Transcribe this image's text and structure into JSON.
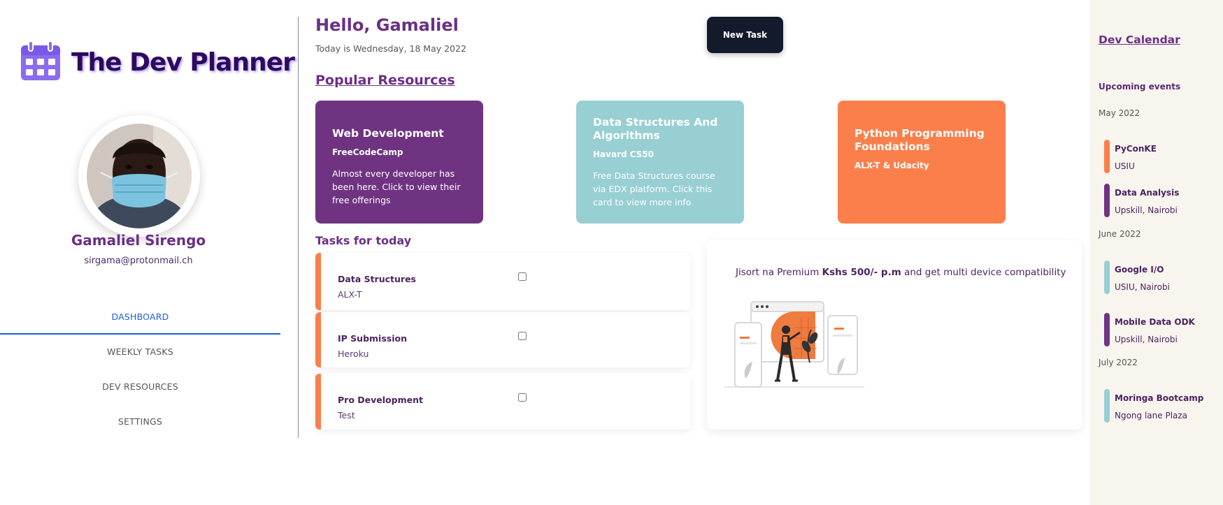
{
  "app": {
    "title": "The Dev Planner"
  },
  "colors": {
    "purple": "#6f3381",
    "teal": "#97cfd3",
    "orange": "#fb7f4b",
    "navy": "#121a2b",
    "nav_active": "#1d5fd6",
    "calendar_bg": "#f8f4ee"
  },
  "profile": {
    "name": "Gamaliel Sirengo",
    "email": "sirgama@protonmail.ch"
  },
  "nav": [
    {
      "label": "DASHBOARD",
      "active": true
    },
    {
      "label": "WEEKLY TASKS",
      "active": false
    },
    {
      "label": "DEV RESOURCES",
      "active": false
    },
    {
      "label": "SETTINGS",
      "active": false
    }
  ],
  "header": {
    "greeting": "Hello, Gamaliel",
    "date": "Today is Wednesday, 18 May 2022",
    "new_task_label": "New Task"
  },
  "resources": {
    "title": "Popular Resources",
    "cards": [
      {
        "title": "Web Development",
        "provider": "FreeCodeCamp",
        "description": "Almost every developer has been here. Click to view their free offerings",
        "color": "#6f3381"
      },
      {
        "title": "Data Structures And Algorithms",
        "provider": "Havard CS50",
        "description": "Free Data Structures course via EDX platform. Click this card to view more info",
        "color": "#97cfd3"
      },
      {
        "title": "Python Programming Foundations",
        "provider": "ALX-T & Udacity",
        "description": "",
        "color": "#fb7f4b"
      }
    ]
  },
  "tasks": {
    "title": "Tasks for today",
    "items": [
      {
        "name": "Data Structures",
        "source": "ALX-T",
        "done": false
      },
      {
        "name": "IP Submission",
        "source": "Heroku",
        "done": false
      },
      {
        "name": "Pro Development",
        "source": "Test",
        "done": false
      }
    ]
  },
  "promo": {
    "prefix": "Jisort na Premium ",
    "highlight": "Kshs 500/- p.m",
    "suffix": " and get multi device compatibility",
    "illustration": "multi-device-illustration"
  },
  "calendar": {
    "title": "Dev Calendar",
    "upcoming_label": "Upcoming events",
    "months": [
      {
        "label": "May 2022",
        "events": [
          {
            "name": "PyConKE",
            "location": "USIU",
            "color": "#fb7f4b"
          },
          {
            "name": "Data Analysis",
            "location": "Upskill, Nairobi",
            "color": "#6f3381"
          }
        ]
      },
      {
        "label": "June 2022",
        "events": [
          {
            "name": "Google I/O",
            "location": "USIU, Nairobi",
            "color": "#97cfd3"
          },
          {
            "name": "Mobile Data ODK",
            "location": "Upskill, Nairobi",
            "color": "#6f3381"
          }
        ]
      },
      {
        "label": "July 2022",
        "events": [
          {
            "name": "Moringa Bootcamp",
            "location": "Ngong lane Plaza",
            "color": "#97cfd3"
          }
        ]
      }
    ]
  }
}
